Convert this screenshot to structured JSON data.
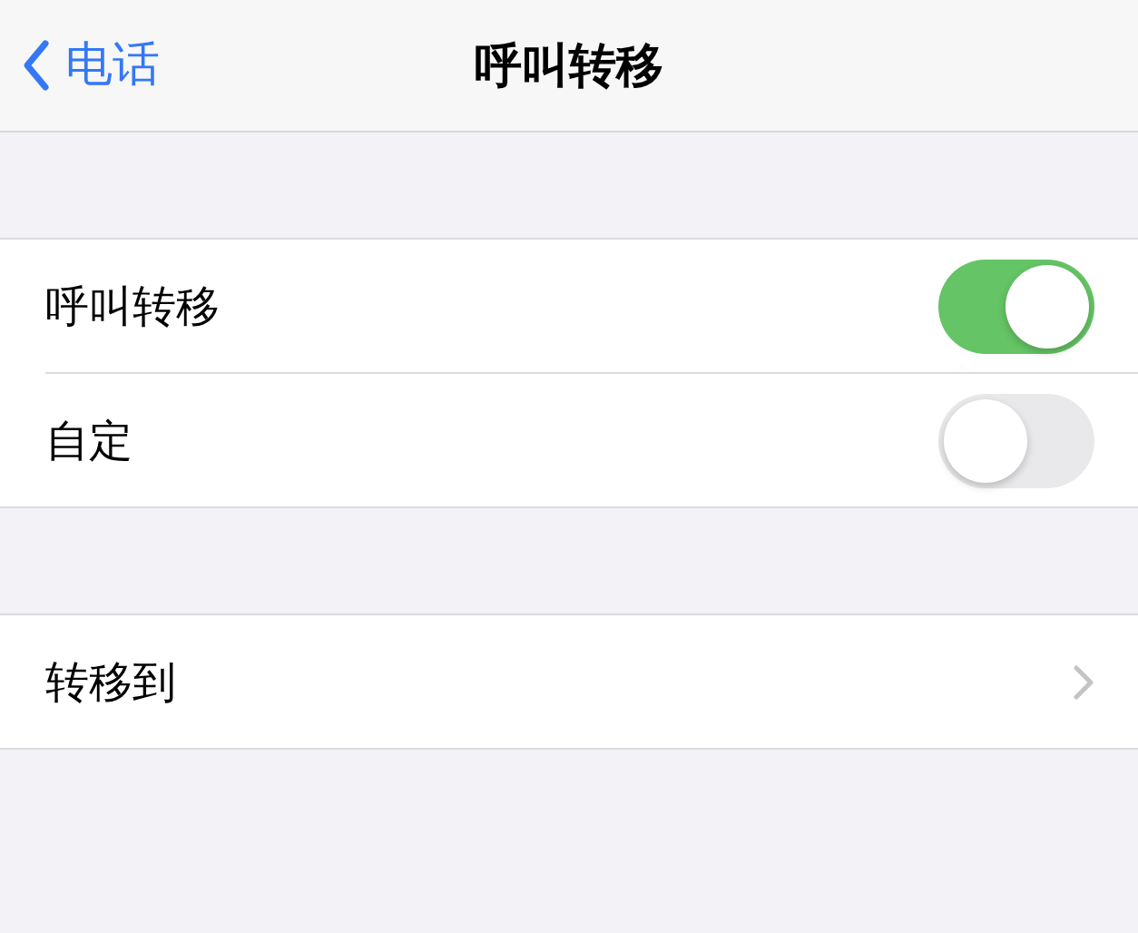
{
  "nav": {
    "back_label": "电话",
    "title": "呼叫转移"
  },
  "sections": [
    {
      "rows": [
        {
          "kind": "toggle",
          "label": "呼叫转移",
          "on": true
        },
        {
          "kind": "toggle",
          "label": "自定",
          "on": false
        }
      ]
    },
    {
      "rows": [
        {
          "kind": "link",
          "label": "转移到"
        }
      ]
    }
  ]
}
